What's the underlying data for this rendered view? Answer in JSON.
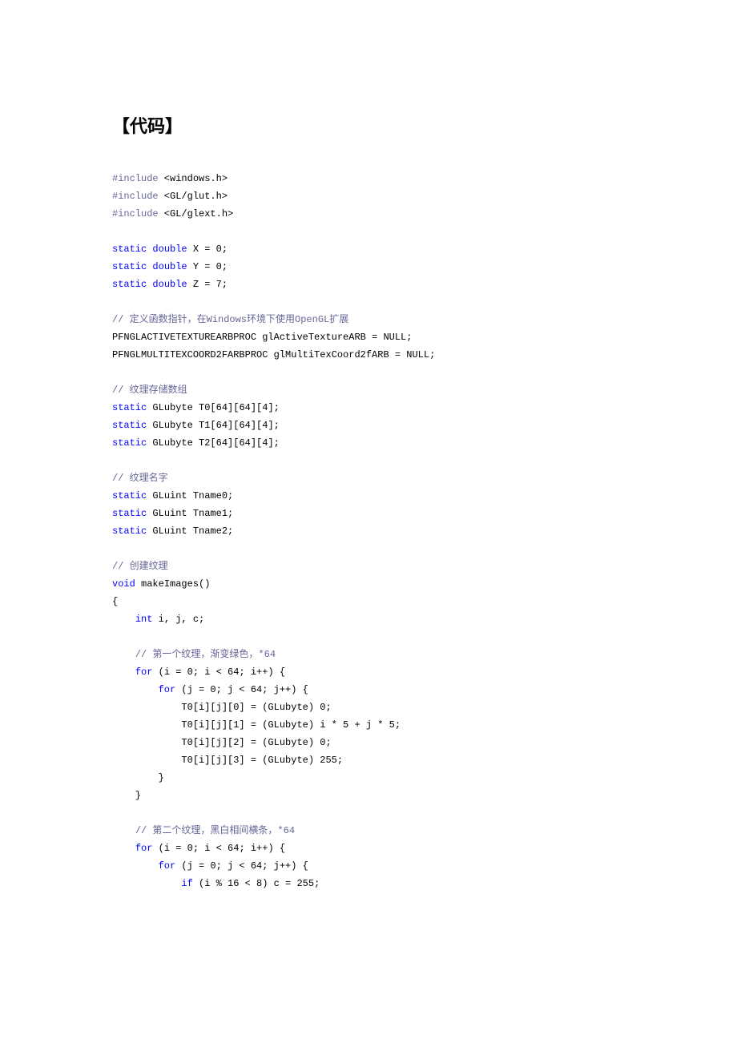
{
  "heading": "【代码】",
  "code": {
    "l01a": "#include",
    "l01b": " <windows.h>",
    "l02a": "#include",
    "l02b": " <GL/glut.h>",
    "l03a": "#include",
    "l03b": " <GL/glext.h>",
    "blank1": "",
    "l04a": "static",
    "l04b": " double",
    "l04c": " X = 0;",
    "l05a": "static",
    "l05b": " double",
    "l05c": " Y = 0;",
    "l06a": "static",
    "l06b": " double",
    "l06c": " Z = 7;",
    "blank2": "",
    "l07": "// 定义函数指针，在Windows环境下使用OpenGL扩展",
    "l08": "PFNGLACTIVETEXTUREARBPROC glActiveTextureARB = NULL;",
    "l09": "PFNGLMULTITEXCOORD2FARBPROC glMultiTexCoord2fARB = NULL;",
    "blank3": "",
    "l10": "// 纹理存储数组",
    "l11a": "static",
    "l11b": " GLubyte T0[64][64][4];",
    "l12a": "static",
    "l12b": " GLubyte T1[64][64][4];",
    "l13a": "static",
    "l13b": " GLubyte T2[64][64][4];",
    "blank4": "",
    "l14": "// 纹理名字",
    "l15a": "static",
    "l15b": " GLuint Tname0;",
    "l16a": "static",
    "l16b": " GLuint Tname1;",
    "l17a": "static",
    "l17b": " GLuint Tname2;",
    "blank5": "",
    "l18": "// 创建纹理",
    "l19a": "void",
    "l19b": " makeImages()",
    "l20": "{",
    "l21a": "    ",
    "l21b": "int",
    "l21c": " i, j, c;",
    "blank6": "",
    "l22a": "    ",
    "l22b": "// 第一个纹理，渐变绿色，*64",
    "l23a": "    ",
    "l23b": "for",
    "l23c": " (i = 0; i < 64; i++) {",
    "l24a": "        ",
    "l24b": "for",
    "l24c": " (j = 0; j < 64; j++) {",
    "l25": "            T0[i][j][0] = (GLubyte) 0;",
    "l26": "            T0[i][j][1] = (GLubyte) i * 5 + j * 5;",
    "l27": "            T0[i][j][2] = (GLubyte) 0;",
    "l28": "            T0[i][j][3] = (GLubyte) 255;",
    "l29": "        }",
    "l30": "    }",
    "blank7": "",
    "l31a": "    ",
    "l31b": "// 第二个纹理，黑白相间横条，*64",
    "l32a": "    ",
    "l32b": "for",
    "l32c": " (i = 0; i < 64; i++) {",
    "l33a": "        ",
    "l33b": "for",
    "l33c": " (j = 0; j < 64; j++) {",
    "l34a": "            ",
    "l34b": "if",
    "l34c": " (i % 16 < 8) c = 255;"
  }
}
